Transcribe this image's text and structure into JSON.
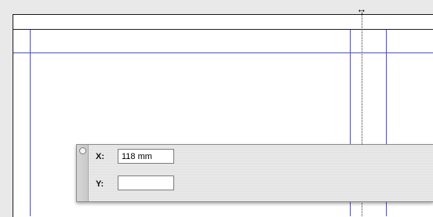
{
  "control_panel": {
    "x_label": "X:",
    "x_value": "118 mm",
    "y_label": "Y:",
    "y_value": ""
  },
  "colors": {
    "guide": "#4d4fb4",
    "page": "#ffffff",
    "pasteboard": "#e9e9e9"
  },
  "cursor": {
    "icon": "resize-horizontal-icon",
    "glyph": "↔"
  }
}
